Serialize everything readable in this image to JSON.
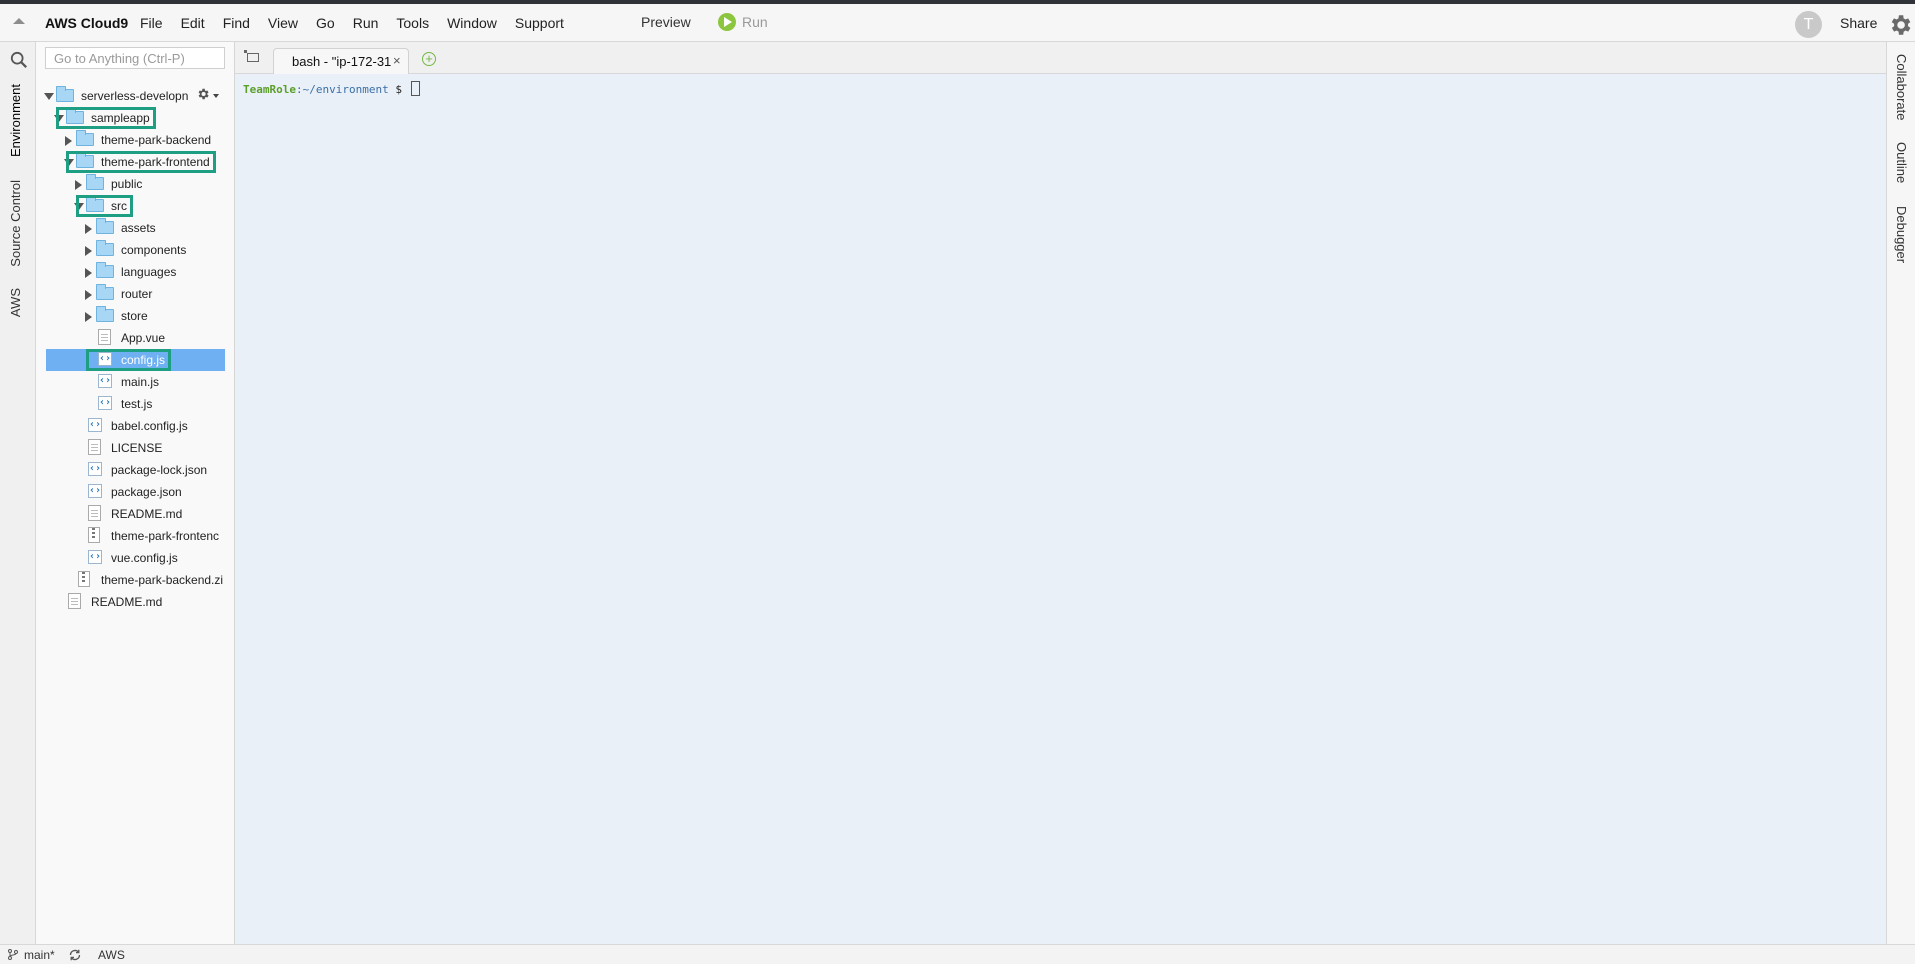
{
  "app": {
    "brand": "AWS Cloud9",
    "menus": [
      "File",
      "Edit",
      "Find",
      "View",
      "Go",
      "Run",
      "Tools",
      "Window",
      "Support"
    ],
    "preview_label": "Preview",
    "run_label": "Run",
    "avatar_initial": "T",
    "share_label": "Share"
  },
  "left_rail": {
    "tabs": [
      "Environment",
      "Source Control",
      "AWS"
    ]
  },
  "search": {
    "placeholder": "Go to Anything (Ctrl-P)"
  },
  "tree": [
    {
      "label": "serverless-developn",
      "type": "folder",
      "depth": 0,
      "expanded": true
    },
    {
      "label": "sampleapp",
      "type": "folder",
      "depth": 1,
      "expanded": true,
      "highlighted": true
    },
    {
      "label": "theme-park-backend",
      "type": "folder",
      "depth": 2,
      "expanded": false
    },
    {
      "label": "theme-park-frontend",
      "type": "folder",
      "depth": 2,
      "expanded": true,
      "highlighted": true
    },
    {
      "label": "public",
      "type": "folder",
      "depth": 3,
      "expanded": false
    },
    {
      "label": "src",
      "type": "folder",
      "depth": 3,
      "expanded": true,
      "highlighted": true
    },
    {
      "label": "assets",
      "type": "folder",
      "depth": 4,
      "expanded": false
    },
    {
      "label": "components",
      "type": "folder",
      "depth": 4,
      "expanded": false
    },
    {
      "label": "languages",
      "type": "folder",
      "depth": 4,
      "expanded": false
    },
    {
      "label": "router",
      "type": "folder",
      "depth": 4,
      "expanded": false
    },
    {
      "label": "store",
      "type": "folder",
      "depth": 4,
      "expanded": false
    },
    {
      "label": "App.vue",
      "type": "file",
      "depth": 4
    },
    {
      "label": "config.js",
      "type": "js",
      "depth": 4,
      "selected": true,
      "highlighted": true
    },
    {
      "label": "main.js",
      "type": "js",
      "depth": 4
    },
    {
      "label": "test.js",
      "type": "js",
      "depth": 4
    },
    {
      "label": "babel.config.js",
      "type": "js",
      "depth": 3
    },
    {
      "label": "LICENSE",
      "type": "file",
      "depth": 3
    },
    {
      "label": "package-lock.json",
      "type": "js",
      "depth": 3
    },
    {
      "label": "package.json",
      "type": "js",
      "depth": 3
    },
    {
      "label": "README.md",
      "type": "file",
      "depth": 3
    },
    {
      "label": "theme-park-frontenc",
      "type": "zip",
      "depth": 3
    },
    {
      "label": "vue.config.js",
      "type": "js",
      "depth": 3
    },
    {
      "label": "theme-park-backend.zi",
      "type": "zip",
      "depth": 2
    },
    {
      "label": "README.md",
      "type": "file",
      "depth": 1
    }
  ],
  "editor": {
    "tab_label": "bash - \"ip-172-31",
    "tab_close": "×"
  },
  "terminal": {
    "role": "TeamRole",
    "path": "~/environment",
    "prompt": " $ "
  },
  "right_rail": {
    "tabs": [
      "Collaborate",
      "Outline",
      "Debugger"
    ]
  },
  "status": {
    "branch": "main*",
    "aws": "AWS"
  },
  "colors": {
    "highlight_box": "#1e9e82",
    "selection": "#6fb0f2",
    "terminal_bg": "#eaf0f7"
  }
}
